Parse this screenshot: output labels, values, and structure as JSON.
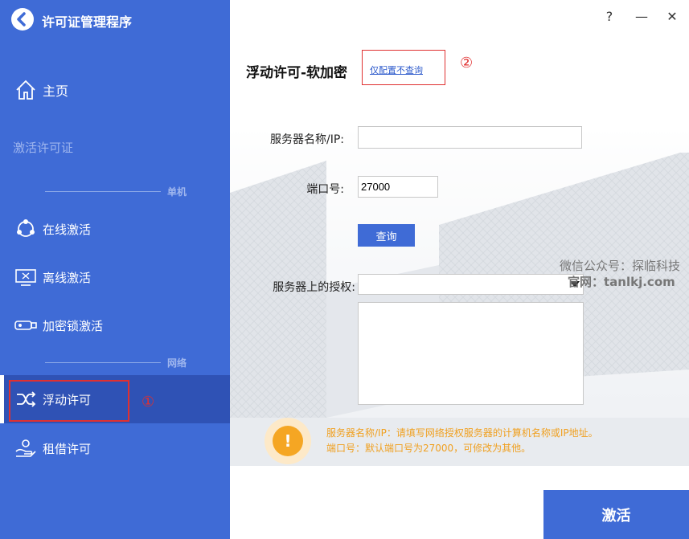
{
  "app": {
    "title": "许可证管理程序"
  },
  "sidebar": {
    "home": "主页",
    "activate_license": "激活许可证",
    "section_standalone": "单机",
    "online_activation": "在线激活",
    "offline_activation": "离线激活",
    "dongle_activation": "加密锁激活",
    "section_network": "网络",
    "floating_license": "浮动许可",
    "lease_license": "租借许可"
  },
  "annotations": {
    "marker_1": "①",
    "marker_2": "②"
  },
  "window": {
    "help": "?",
    "minimize": "—",
    "close": "✕"
  },
  "main": {
    "title": "浮动许可-软加密",
    "config_only_link": "仅配置不查询",
    "server_label": "服务器名称/IP:",
    "server_value": "",
    "port_label": "端口号:",
    "port_value": "27000",
    "query_button": "查询",
    "licenses_label": "服务器上的授权:",
    "licenses_selected": "",
    "hint_icon": "!",
    "hint_line_1": "服务器名称/IP：请填写网络授权服务器的计算机名称或IP地址。",
    "hint_line_2": "端口号：默认端口号为27000，可修改为其他。",
    "activate_button": "激活"
  },
  "watermark": {
    "line_1": "微信公众号：探临科技",
    "line_2": "官网：tanlkj.com"
  },
  "colors": {
    "accent": "#3f6bd6",
    "accent_active": "#2f52b5",
    "warning": "#f5a623",
    "annotation": "#e03030"
  }
}
